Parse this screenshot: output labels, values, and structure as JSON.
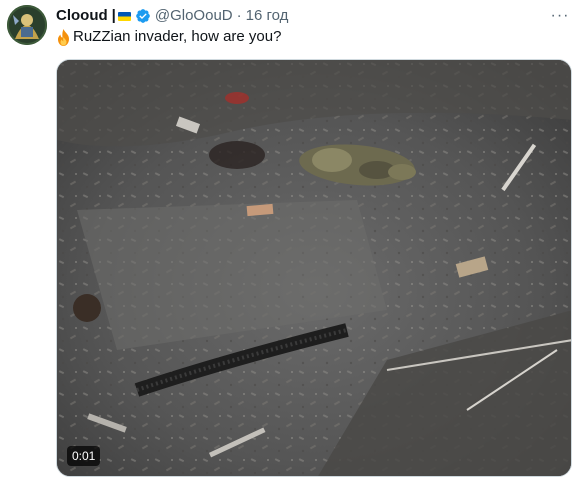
{
  "tweet": {
    "display_name": "Clooud",
    "name_separator": "|",
    "handle": "@GloOouD",
    "dot": "·",
    "time": "16 год",
    "text": "RuZZian invader, how are you?",
    "more_label": "···"
  },
  "media": {
    "type": "video",
    "timer": "0:01"
  },
  "icons": {
    "avatar": "avatar",
    "flag": "ukraine-flag-icon",
    "verified": "verified-badge-icon",
    "fire": "fire-emoji-icon",
    "more": "more-options-icon"
  },
  "colors": {
    "verified": "#1d9bf0",
    "secondary_text": "#536471",
    "flag_blue": "#0057b7",
    "flag_yellow": "#ffd700"
  }
}
